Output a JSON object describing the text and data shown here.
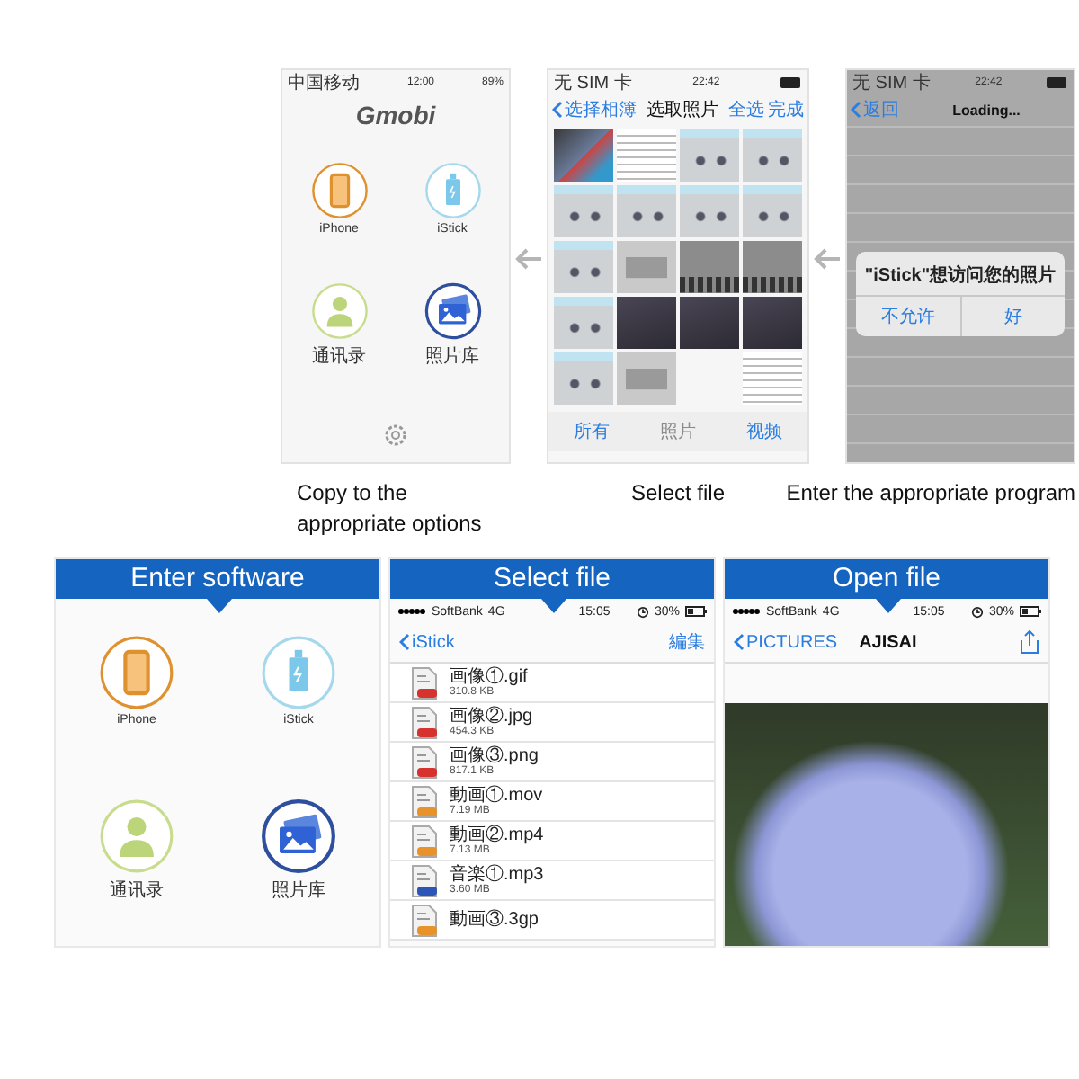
{
  "top_row": {
    "screens": [
      {
        "kind": "home",
        "status": {
          "carrier": "中国移动",
          "time": "12:00",
          "battery": "89%"
        },
        "logo": "Gmobi",
        "apps": [
          {
            "label": "iPhone",
            "kind": "phone"
          },
          {
            "label": "iStick",
            "kind": "stick"
          },
          {
            "label": "通讯录",
            "kind": "contacts"
          },
          {
            "label": "照片库",
            "kind": "photos"
          }
        ],
        "caption": "Copy to the appropriate options"
      },
      {
        "kind": "picker",
        "status": {
          "carrier": "无 SIM 卡",
          "time": "22:42"
        },
        "back": "选择相簿",
        "title": "选取照片",
        "actions": [
          "全选",
          "完成"
        ],
        "thumbnails": [
          {
            "kind": "home"
          },
          {
            "kind": "text"
          },
          {
            "kind": "screenshot"
          },
          {
            "kind": "screenshot"
          },
          {
            "kind": "screenshot"
          },
          {
            "kind": "screenshot"
          },
          {
            "kind": "screenshot"
          },
          {
            "kind": "screenshot"
          },
          {
            "kind": "screenshot"
          },
          {
            "kind": "dialog"
          },
          {
            "kind": "keyboard"
          },
          {
            "kind": "keyboard"
          },
          {
            "kind": "screenshot"
          },
          {
            "kind": "night"
          },
          {
            "kind": "night"
          },
          {
            "kind": "night"
          },
          {
            "kind": "screenshot"
          },
          {
            "kind": "dialog"
          },
          {
            "kind": "gap"
          },
          {
            "kind": "text"
          }
        ],
        "tabs": [
          {
            "label": "所有",
            "disabled": false
          },
          {
            "label": "照片",
            "disabled": true
          },
          {
            "label": "视频",
            "disabled": false
          }
        ],
        "caption": "Select file"
      },
      {
        "kind": "alert",
        "status": {
          "carrier": "无 SIM 卡",
          "time": "22:42"
        },
        "back": "返回",
        "title": "Loading...",
        "alert": {
          "message": "\"iStick\"想访问您的照片",
          "buttons": [
            "不允许",
            "好"
          ]
        },
        "caption": "Enter the appropriate program"
      }
    ]
  },
  "bottom_row": {
    "panels": [
      {
        "kind": "home",
        "banner": "Enter software",
        "apps": [
          {
            "label": "iPhone",
            "kind": "phone"
          },
          {
            "label": "iStick",
            "kind": "stick"
          },
          {
            "label": "通讯录",
            "kind": "contacts"
          },
          {
            "label": "照片库",
            "kind": "photos"
          }
        ]
      },
      {
        "kind": "files",
        "banner": "Select file",
        "status": {
          "carrier": "SoftBank",
          "network": "4G",
          "time": "15:05",
          "battery": "30%"
        },
        "back": "iStick",
        "action": "編集",
        "files": [
          {
            "name": "画像①.gif",
            "size": "310.8 KB",
            "color": "#d6322e"
          },
          {
            "name": "画像②.jpg",
            "size": "454.3 KB",
            "color": "#d6322e"
          },
          {
            "name": "画像③.png",
            "size": "817.1 KB",
            "color": "#d6322e"
          },
          {
            "name": "動画①.mov",
            "size": "7.19 MB",
            "color": "#e8922c"
          },
          {
            "name": "動画②.mp4",
            "size": "7.13 MB",
            "color": "#e8922c"
          },
          {
            "name": "音楽①.mp3",
            "size": "3.60 MB",
            "color": "#2c55b8"
          },
          {
            "name": "動画③.3gp",
            "color": "#e8922c"
          }
        ]
      },
      {
        "kind": "viewer",
        "banner": "Open file",
        "status": {
          "carrier": "SoftBank",
          "network": "4G",
          "time": "15:05",
          "battery": "30%"
        },
        "back": "PICTURES",
        "title": "AJISAI"
      }
    ]
  }
}
